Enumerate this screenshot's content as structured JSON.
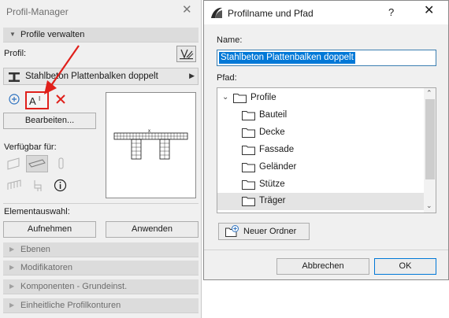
{
  "palette": {
    "title": "Profil-Manager",
    "section_manage": "Profile verwalten",
    "profile_label": "Profil:",
    "profile_value": "Stahlbeton Plattenbalken doppelt",
    "edit_button": "Bearbeiten...",
    "available_label": "Verfügbar für:",
    "element_selection_label": "Elementauswahl:",
    "capture_button": "Aufnehmen",
    "apply_button": "Anwenden",
    "collapsed_sections": [
      "Ebenen",
      "Modifikatoren",
      "Komponenten - Grundeinst.",
      "Einheitliche Profilkonturen"
    ]
  },
  "dialog": {
    "title": "Profilname und Pfad",
    "help": "?",
    "name_label": "Name:",
    "name_value": "Stahlbeton Plattenbalken doppelt",
    "path_label": "Pfad:",
    "root_folder": "Profile",
    "folders": [
      "Bauteil",
      "Decke",
      "Fassade",
      "Geländer",
      "Stütze",
      "Träger"
    ],
    "selected_folder": "Träger",
    "new_folder_button": "Neuer Ordner",
    "cancel_button": "Abbrechen",
    "ok_button": "OK"
  },
  "colors": {
    "accent": "#0078d7",
    "highlight_red": "#e0201b",
    "panel_bg": "#f0f0f0",
    "section_bg": "#dcdcdc"
  }
}
